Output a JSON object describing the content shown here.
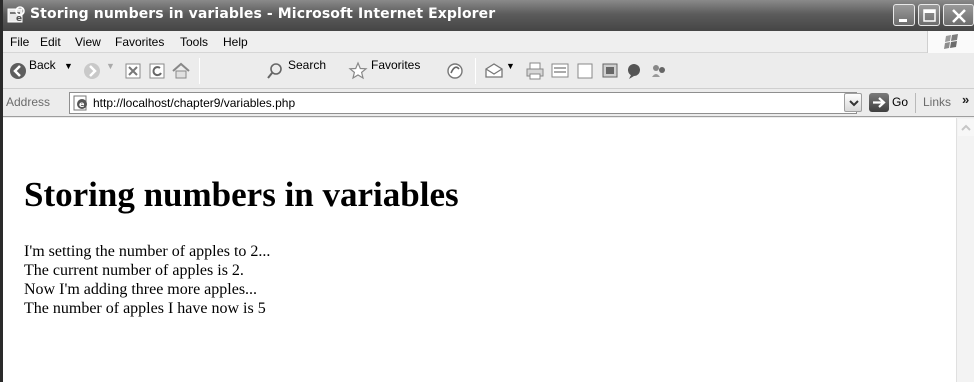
{
  "window": {
    "title": "Storing numbers in variables - Microsoft Internet Explorer"
  },
  "menu": {
    "items": [
      "File",
      "Edit",
      "View",
      "Favorites",
      "Tools",
      "Help"
    ]
  },
  "toolbar": {
    "back_label": "Back",
    "search_label": "Search",
    "favorites_label": "Favorites"
  },
  "address": {
    "label": "Address",
    "url": "http://localhost/chapter9/variables.php",
    "go_label": "Go",
    "links_label": "Links",
    "links_chevron": "»"
  },
  "page": {
    "heading": "Storing numbers in variables",
    "lines": [
      "I'm setting the number of apples to 2...",
      "The current number of apples is 2.",
      "Now I'm adding three more apples...",
      "The number of apples I have now is 5"
    ]
  }
}
